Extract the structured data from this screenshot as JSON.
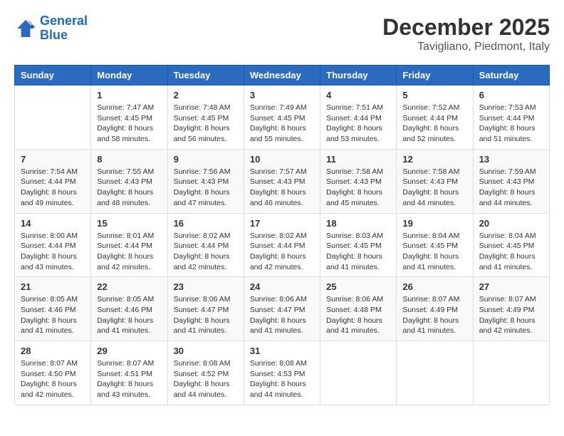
{
  "logo": {
    "text_general": "General",
    "text_blue": "Blue"
  },
  "header": {
    "month": "December 2025",
    "location": "Tavigliano, Piedmont, Italy"
  },
  "days_of_week": [
    "Sunday",
    "Monday",
    "Tuesday",
    "Wednesday",
    "Thursday",
    "Friday",
    "Saturday"
  ],
  "weeks": [
    [
      {
        "day": "",
        "content": ""
      },
      {
        "day": "1",
        "content": "Sunrise: 7:47 AM\nSunset: 4:45 PM\nDaylight: 8 hours\nand 58 minutes."
      },
      {
        "day": "2",
        "content": "Sunrise: 7:48 AM\nSunset: 4:45 PM\nDaylight: 8 hours\nand 56 minutes."
      },
      {
        "day": "3",
        "content": "Sunrise: 7:49 AM\nSunset: 4:45 PM\nDaylight: 8 hours\nand 55 minutes."
      },
      {
        "day": "4",
        "content": "Sunrise: 7:51 AM\nSunset: 4:44 PM\nDaylight: 8 hours\nand 53 minutes."
      },
      {
        "day": "5",
        "content": "Sunrise: 7:52 AM\nSunset: 4:44 PM\nDaylight: 8 hours\nand 52 minutes."
      },
      {
        "day": "6",
        "content": "Sunrise: 7:53 AM\nSunset: 4:44 PM\nDaylight: 8 hours\nand 51 minutes."
      }
    ],
    [
      {
        "day": "7",
        "content": "Sunrise: 7:54 AM\nSunset: 4:44 PM\nDaylight: 8 hours\nand 49 minutes."
      },
      {
        "day": "8",
        "content": "Sunrise: 7:55 AM\nSunset: 4:43 PM\nDaylight: 8 hours\nand 48 minutes."
      },
      {
        "day": "9",
        "content": "Sunrise: 7:56 AM\nSunset: 4:43 PM\nDaylight: 8 hours\nand 47 minutes."
      },
      {
        "day": "10",
        "content": "Sunrise: 7:57 AM\nSunset: 4:43 PM\nDaylight: 8 hours\nand 46 minutes."
      },
      {
        "day": "11",
        "content": "Sunrise: 7:58 AM\nSunset: 4:43 PM\nDaylight: 8 hours\nand 45 minutes."
      },
      {
        "day": "12",
        "content": "Sunrise: 7:58 AM\nSunset: 4:43 PM\nDaylight: 8 hours\nand 44 minutes."
      },
      {
        "day": "13",
        "content": "Sunrise: 7:59 AM\nSunset: 4:43 PM\nDaylight: 8 hours\nand 44 minutes."
      }
    ],
    [
      {
        "day": "14",
        "content": "Sunrise: 8:00 AM\nSunset: 4:44 PM\nDaylight: 8 hours\nand 43 minutes."
      },
      {
        "day": "15",
        "content": "Sunrise: 8:01 AM\nSunset: 4:44 PM\nDaylight: 8 hours\nand 42 minutes."
      },
      {
        "day": "16",
        "content": "Sunrise: 8:02 AM\nSunset: 4:44 PM\nDaylight: 8 hours\nand 42 minutes."
      },
      {
        "day": "17",
        "content": "Sunrise: 8:02 AM\nSunset: 4:44 PM\nDaylight: 8 hours\nand 42 minutes."
      },
      {
        "day": "18",
        "content": "Sunrise: 8:03 AM\nSunset: 4:45 PM\nDaylight: 8 hours\nand 41 minutes."
      },
      {
        "day": "19",
        "content": "Sunrise: 8:04 AM\nSunset: 4:45 PM\nDaylight: 8 hours\nand 41 minutes."
      },
      {
        "day": "20",
        "content": "Sunrise: 8:04 AM\nSunset: 4:45 PM\nDaylight: 8 hours\nand 41 minutes."
      }
    ],
    [
      {
        "day": "21",
        "content": "Sunrise: 8:05 AM\nSunset: 4:46 PM\nDaylight: 8 hours\nand 41 minutes."
      },
      {
        "day": "22",
        "content": "Sunrise: 8:05 AM\nSunset: 4:46 PM\nDaylight: 8 hours\nand 41 minutes."
      },
      {
        "day": "23",
        "content": "Sunrise: 8:06 AM\nSunset: 4:47 PM\nDaylight: 8 hours\nand 41 minutes."
      },
      {
        "day": "24",
        "content": "Sunrise: 8:06 AM\nSunset: 4:47 PM\nDaylight: 8 hours\nand 41 minutes."
      },
      {
        "day": "25",
        "content": "Sunrise: 8:06 AM\nSunset: 4:48 PM\nDaylight: 8 hours\nand 41 minutes."
      },
      {
        "day": "26",
        "content": "Sunrise: 8:07 AM\nSunset: 4:49 PM\nDaylight: 8 hours\nand 41 minutes."
      },
      {
        "day": "27",
        "content": "Sunrise: 8:07 AM\nSunset: 4:49 PM\nDaylight: 8 hours\nand 42 minutes."
      }
    ],
    [
      {
        "day": "28",
        "content": "Sunrise: 8:07 AM\nSunset: 4:50 PM\nDaylight: 8 hours\nand 42 minutes."
      },
      {
        "day": "29",
        "content": "Sunrise: 8:07 AM\nSunset: 4:51 PM\nDaylight: 8 hours\nand 43 minutes."
      },
      {
        "day": "30",
        "content": "Sunrise: 8:08 AM\nSunset: 4:52 PM\nDaylight: 8 hours\nand 44 minutes."
      },
      {
        "day": "31",
        "content": "Sunrise: 8:08 AM\nSunset: 4:53 PM\nDaylight: 8 hours\nand 44 minutes."
      },
      {
        "day": "",
        "content": ""
      },
      {
        "day": "",
        "content": ""
      },
      {
        "day": "",
        "content": ""
      }
    ]
  ]
}
